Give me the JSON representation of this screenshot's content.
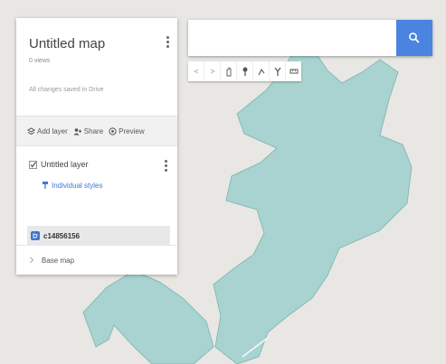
{
  "panel": {
    "title": "Untitled map",
    "subtitle": "0 views",
    "description": "All changes saved in Drive",
    "actions": {
      "add_layer": "Add layer",
      "share": "Share",
      "preview": "Preview"
    },
    "layer": {
      "title": "Untitled layer",
      "style_link": "Individual styles",
      "data_item": "c14856156"
    },
    "base_map": "Base map"
  },
  "search": {
    "value": "",
    "placeholder": ""
  },
  "colors": {
    "region_fill": "#a9d3d0",
    "region_stroke": "#86bab6",
    "accent": "#4b83e0"
  }
}
